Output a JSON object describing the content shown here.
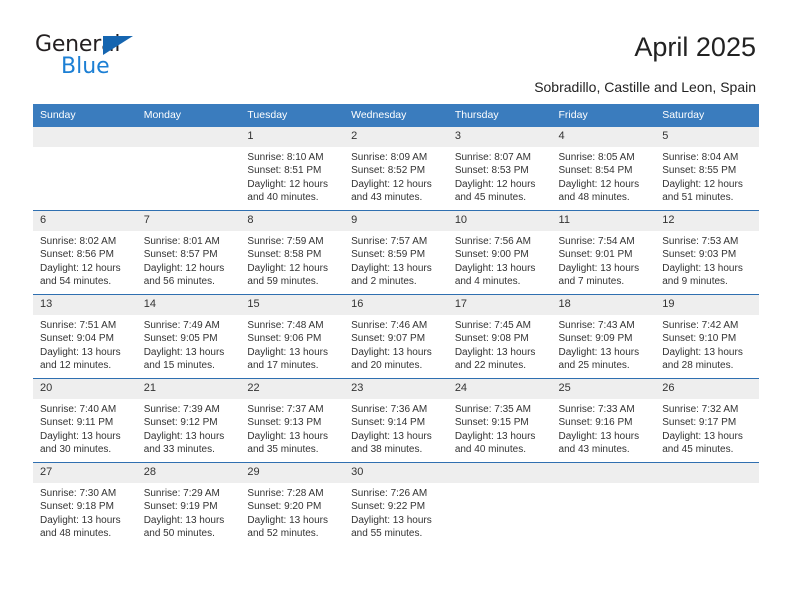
{
  "brand": {
    "name_top": "General",
    "name_bottom": "Blue",
    "triangle_color": "#1565b0",
    "blue_color": "#1c7fd4"
  },
  "header": {
    "title": "April 2025",
    "subtitle": "Sobradillo, Castille and Leon, Spain"
  },
  "theme": {
    "header_bg": "#3a7cbe",
    "row_divider": "#2f6fb0",
    "daynum_bg": "#eeeeee",
    "text": "#333333"
  },
  "weekday_headers": [
    "Sunday",
    "Monday",
    "Tuesday",
    "Wednesday",
    "Thursday",
    "Friday",
    "Saturday"
  ],
  "weeks": [
    [
      {
        "day": "",
        "sunrise": "",
        "sunset": "",
        "daylight": "",
        "daylight2": ""
      },
      {
        "day": "",
        "sunrise": "",
        "sunset": "",
        "daylight": "",
        "daylight2": ""
      },
      {
        "day": "1",
        "sunrise": "Sunrise: 8:10 AM",
        "sunset": "Sunset: 8:51 PM",
        "daylight": "Daylight: 12 hours",
        "daylight2": "and 40 minutes."
      },
      {
        "day": "2",
        "sunrise": "Sunrise: 8:09 AM",
        "sunset": "Sunset: 8:52 PM",
        "daylight": "Daylight: 12 hours",
        "daylight2": "and 43 minutes."
      },
      {
        "day": "3",
        "sunrise": "Sunrise: 8:07 AM",
        "sunset": "Sunset: 8:53 PM",
        "daylight": "Daylight: 12 hours",
        "daylight2": "and 45 minutes."
      },
      {
        "day": "4",
        "sunrise": "Sunrise: 8:05 AM",
        "sunset": "Sunset: 8:54 PM",
        "daylight": "Daylight: 12 hours",
        "daylight2": "and 48 minutes."
      },
      {
        "day": "5",
        "sunrise": "Sunrise: 8:04 AM",
        "sunset": "Sunset: 8:55 PM",
        "daylight": "Daylight: 12 hours",
        "daylight2": "and 51 minutes."
      }
    ],
    [
      {
        "day": "6",
        "sunrise": "Sunrise: 8:02 AM",
        "sunset": "Sunset: 8:56 PM",
        "daylight": "Daylight: 12 hours",
        "daylight2": "and 54 minutes."
      },
      {
        "day": "7",
        "sunrise": "Sunrise: 8:01 AM",
        "sunset": "Sunset: 8:57 PM",
        "daylight": "Daylight: 12 hours",
        "daylight2": "and 56 minutes."
      },
      {
        "day": "8",
        "sunrise": "Sunrise: 7:59 AM",
        "sunset": "Sunset: 8:58 PM",
        "daylight": "Daylight: 12 hours",
        "daylight2": "and 59 minutes."
      },
      {
        "day": "9",
        "sunrise": "Sunrise: 7:57 AM",
        "sunset": "Sunset: 8:59 PM",
        "daylight": "Daylight: 13 hours",
        "daylight2": "and 2 minutes."
      },
      {
        "day": "10",
        "sunrise": "Sunrise: 7:56 AM",
        "sunset": "Sunset: 9:00 PM",
        "daylight": "Daylight: 13 hours",
        "daylight2": "and 4 minutes."
      },
      {
        "day": "11",
        "sunrise": "Sunrise: 7:54 AM",
        "sunset": "Sunset: 9:01 PM",
        "daylight": "Daylight: 13 hours",
        "daylight2": "and 7 minutes."
      },
      {
        "day": "12",
        "sunrise": "Sunrise: 7:53 AM",
        "sunset": "Sunset: 9:03 PM",
        "daylight": "Daylight: 13 hours",
        "daylight2": "and 9 minutes."
      }
    ],
    [
      {
        "day": "13",
        "sunrise": "Sunrise: 7:51 AM",
        "sunset": "Sunset: 9:04 PM",
        "daylight": "Daylight: 13 hours",
        "daylight2": "and 12 minutes."
      },
      {
        "day": "14",
        "sunrise": "Sunrise: 7:49 AM",
        "sunset": "Sunset: 9:05 PM",
        "daylight": "Daylight: 13 hours",
        "daylight2": "and 15 minutes."
      },
      {
        "day": "15",
        "sunrise": "Sunrise: 7:48 AM",
        "sunset": "Sunset: 9:06 PM",
        "daylight": "Daylight: 13 hours",
        "daylight2": "and 17 minutes."
      },
      {
        "day": "16",
        "sunrise": "Sunrise: 7:46 AM",
        "sunset": "Sunset: 9:07 PM",
        "daylight": "Daylight: 13 hours",
        "daylight2": "and 20 minutes."
      },
      {
        "day": "17",
        "sunrise": "Sunrise: 7:45 AM",
        "sunset": "Sunset: 9:08 PM",
        "daylight": "Daylight: 13 hours",
        "daylight2": "and 22 minutes."
      },
      {
        "day": "18",
        "sunrise": "Sunrise: 7:43 AM",
        "sunset": "Sunset: 9:09 PM",
        "daylight": "Daylight: 13 hours",
        "daylight2": "and 25 minutes."
      },
      {
        "day": "19",
        "sunrise": "Sunrise: 7:42 AM",
        "sunset": "Sunset: 9:10 PM",
        "daylight": "Daylight: 13 hours",
        "daylight2": "and 28 minutes."
      }
    ],
    [
      {
        "day": "20",
        "sunrise": "Sunrise: 7:40 AM",
        "sunset": "Sunset: 9:11 PM",
        "daylight": "Daylight: 13 hours",
        "daylight2": "and 30 minutes."
      },
      {
        "day": "21",
        "sunrise": "Sunrise: 7:39 AM",
        "sunset": "Sunset: 9:12 PM",
        "daylight": "Daylight: 13 hours",
        "daylight2": "and 33 minutes."
      },
      {
        "day": "22",
        "sunrise": "Sunrise: 7:37 AM",
        "sunset": "Sunset: 9:13 PM",
        "daylight": "Daylight: 13 hours",
        "daylight2": "and 35 minutes."
      },
      {
        "day": "23",
        "sunrise": "Sunrise: 7:36 AM",
        "sunset": "Sunset: 9:14 PM",
        "daylight": "Daylight: 13 hours",
        "daylight2": "and 38 minutes."
      },
      {
        "day": "24",
        "sunrise": "Sunrise: 7:35 AM",
        "sunset": "Sunset: 9:15 PM",
        "daylight": "Daylight: 13 hours",
        "daylight2": "and 40 minutes."
      },
      {
        "day": "25",
        "sunrise": "Sunrise: 7:33 AM",
        "sunset": "Sunset: 9:16 PM",
        "daylight": "Daylight: 13 hours",
        "daylight2": "and 43 minutes."
      },
      {
        "day": "26",
        "sunrise": "Sunrise: 7:32 AM",
        "sunset": "Sunset: 9:17 PM",
        "daylight": "Daylight: 13 hours",
        "daylight2": "and 45 minutes."
      }
    ],
    [
      {
        "day": "27",
        "sunrise": "Sunrise: 7:30 AM",
        "sunset": "Sunset: 9:18 PM",
        "daylight": "Daylight: 13 hours",
        "daylight2": "and 48 minutes."
      },
      {
        "day": "28",
        "sunrise": "Sunrise: 7:29 AM",
        "sunset": "Sunset: 9:19 PM",
        "daylight": "Daylight: 13 hours",
        "daylight2": "and 50 minutes."
      },
      {
        "day": "29",
        "sunrise": "Sunrise: 7:28 AM",
        "sunset": "Sunset: 9:20 PM",
        "daylight": "Daylight: 13 hours",
        "daylight2": "and 52 minutes."
      },
      {
        "day": "30",
        "sunrise": "Sunrise: 7:26 AM",
        "sunset": "Sunset: 9:22 PM",
        "daylight": "Daylight: 13 hours",
        "daylight2": "and 55 minutes."
      },
      {
        "day": "",
        "sunrise": "",
        "sunset": "",
        "daylight": "",
        "daylight2": ""
      },
      {
        "day": "",
        "sunrise": "",
        "sunset": "",
        "daylight": "",
        "daylight2": ""
      },
      {
        "day": "",
        "sunrise": "",
        "sunset": "",
        "daylight": "",
        "daylight2": ""
      }
    ]
  ]
}
